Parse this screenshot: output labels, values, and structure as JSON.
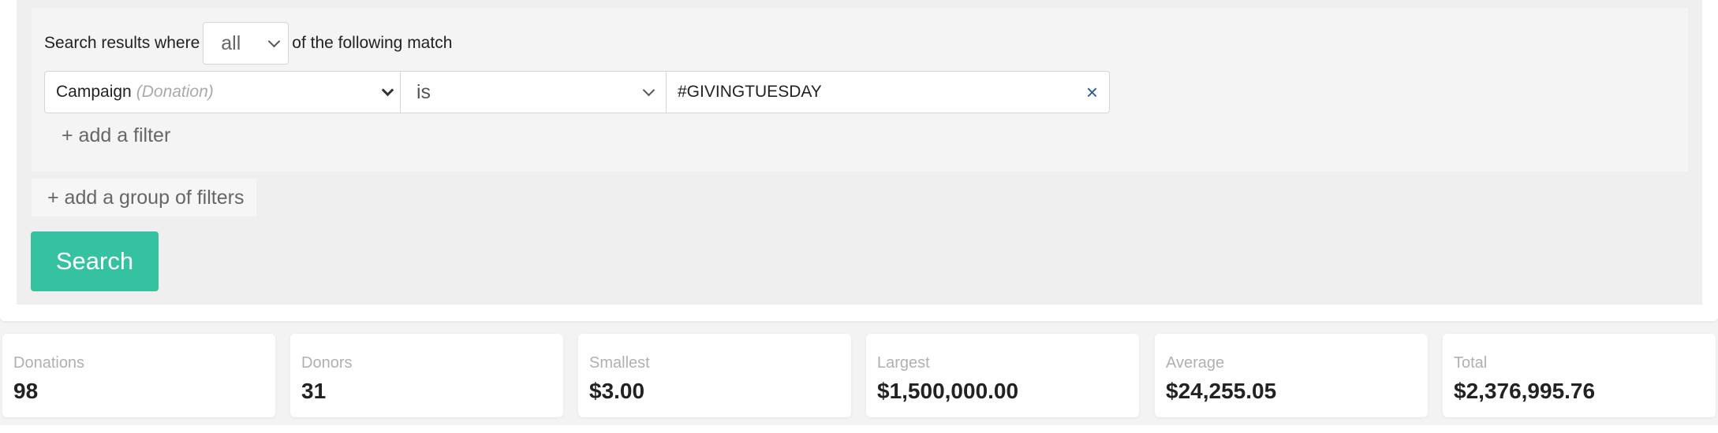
{
  "query": {
    "prefix": "Search results where",
    "match_mode": "all",
    "suffix": "of the following match",
    "filter": {
      "field": "Campaign",
      "field_hint": "(Donation)",
      "operator": "is",
      "value": "#GIVINGTUESDAY",
      "clear_symbol": "×"
    },
    "add_filter_label": "+ add a filter",
    "add_group_label": "+ add a group of filters",
    "search_label": "Search"
  },
  "stats": [
    {
      "label": "Donations",
      "value": "98"
    },
    {
      "label": "Donors",
      "value": "31"
    },
    {
      "label": "Smallest",
      "value": "$3.00"
    },
    {
      "label": "Largest",
      "value": "$1,500,000.00"
    },
    {
      "label": "Average",
      "value": "$24,255.05"
    },
    {
      "label": "Total",
      "value": "$2,376,995.76"
    }
  ],
  "colors": {
    "accent": "#35c2a1",
    "clear_icon": "#2c5d8a"
  },
  "icons": {
    "select_arrow": "chevron-down-icon",
    "clear": "close-icon"
  }
}
